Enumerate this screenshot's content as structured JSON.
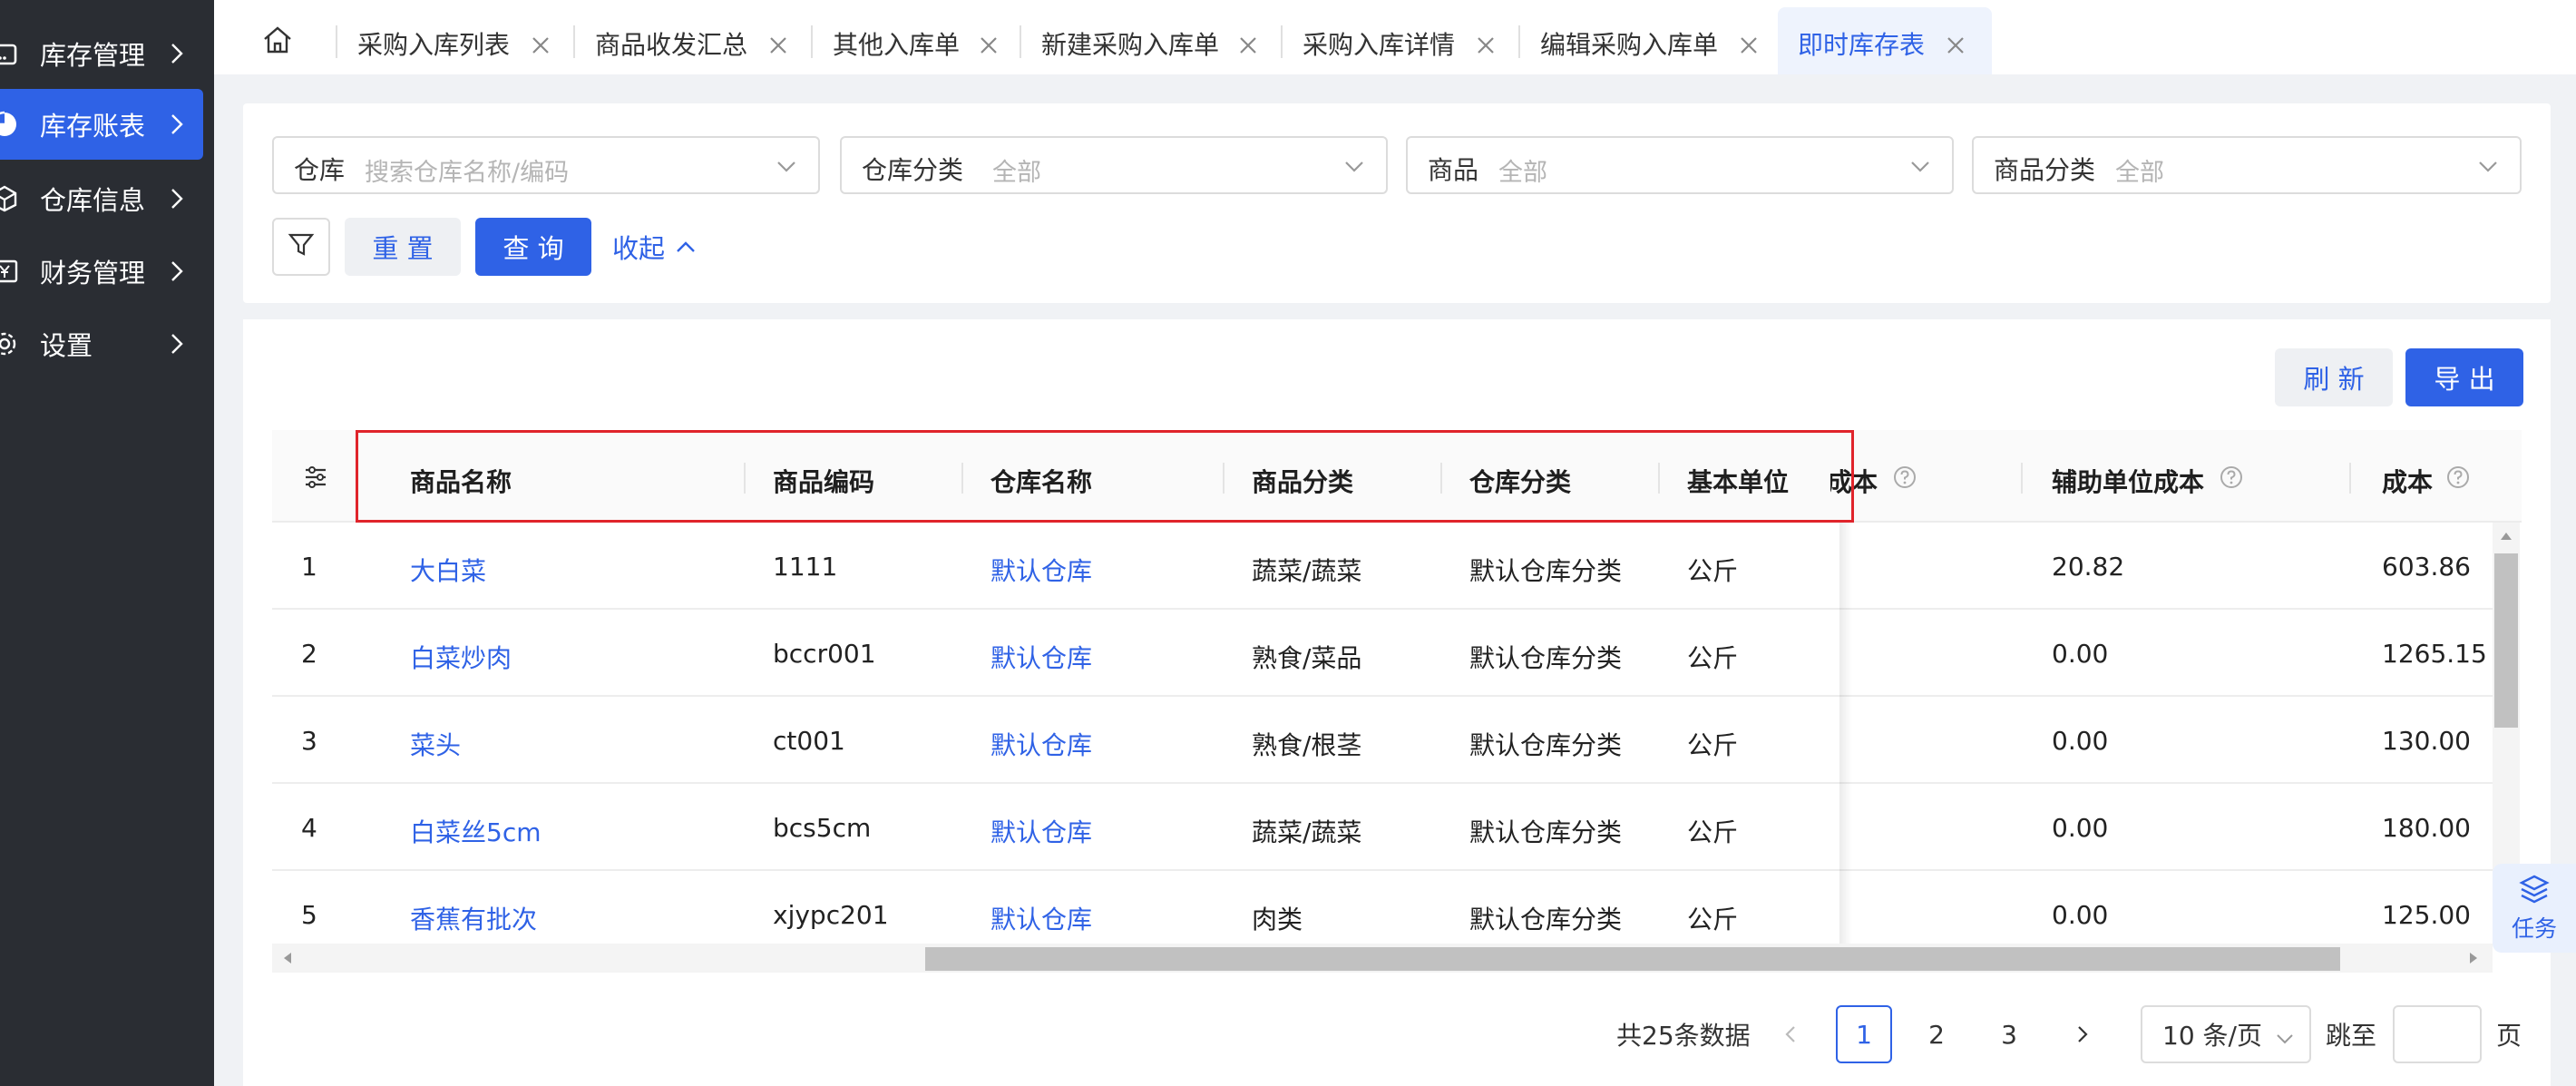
{
  "sidebar": {
    "items": [
      {
        "label": "库存管理",
        "icon": "warehouse-icon",
        "active": false
      },
      {
        "label": "库存账表",
        "icon": "pie-chart-icon",
        "active": true
      },
      {
        "label": "仓库信息",
        "icon": "cube-icon",
        "active": false
      },
      {
        "label": "财务管理",
        "icon": "yuan-register-icon",
        "active": false
      },
      {
        "label": "设置",
        "icon": "gear-icon",
        "active": false
      }
    ]
  },
  "tabs": {
    "home_icon": "home-icon",
    "items": [
      {
        "label": "采购入库列表",
        "active": false
      },
      {
        "label": "商品收发汇总",
        "active": false
      },
      {
        "label": "其他入库单",
        "active": false
      },
      {
        "label": "新建采购入库单",
        "active": false
      },
      {
        "label": "采购入库详情",
        "active": false
      },
      {
        "label": "编辑采购入库单",
        "active": false
      },
      {
        "label": "即时库存表",
        "active": true
      }
    ]
  },
  "filters": {
    "warehouse": {
      "label": "仓库",
      "placeholder": "搜索仓库名称/编码"
    },
    "warehouse_category": {
      "label": "仓库分类",
      "value": "全部"
    },
    "product": {
      "label": "商品",
      "value": "全部"
    },
    "product_category": {
      "label": "商品分类",
      "value": "全部"
    },
    "reset_label": "重 置",
    "query_label": "查 询",
    "collapse_label": "收起"
  },
  "toolbar": {
    "refresh_label": "刷 新",
    "export_label": "导 出"
  },
  "table": {
    "headers": {
      "name": "商品名称",
      "code": "商品编码",
      "warehouse": "仓库名称",
      "category": "商品分类",
      "warehouse_category": "仓库分类",
      "unit": "基本单位",
      "unit_cost_partial": "成本",
      "aux_unit_cost": "辅助单位成本",
      "cost": "成本"
    },
    "rows": [
      {
        "index": "1",
        "name": "大白菜",
        "code": "1111",
        "warehouse": "默认仓库",
        "category": "蔬菜/蔬菜",
        "warehouse_category": "默认仓库分类",
        "unit": "公斤",
        "aux_unit_cost": "20.82",
        "cost": "603.86"
      },
      {
        "index": "2",
        "name": "白菜炒肉",
        "code": "bccr001",
        "warehouse": "默认仓库",
        "category": "熟食/菜品",
        "warehouse_category": "默认仓库分类",
        "unit": "公斤",
        "aux_unit_cost": "0.00",
        "cost": "1265.15"
      },
      {
        "index": "3",
        "name": "菜头",
        "code": "ct001",
        "warehouse": "默认仓库",
        "category": "熟食/根茎",
        "warehouse_category": "默认仓库分类",
        "unit": "公斤",
        "aux_unit_cost": "0.00",
        "cost": "130.00"
      },
      {
        "index": "4",
        "name": "白菜丝5cm",
        "code": "bcs5cm",
        "warehouse": "默认仓库",
        "category": "蔬菜/蔬菜",
        "warehouse_category": "默认仓库分类",
        "unit": "公斤",
        "aux_unit_cost": "0.00",
        "cost": "180.00"
      },
      {
        "index": "5",
        "name": "香蕉有批次",
        "code": "xjypc201",
        "warehouse": "默认仓库",
        "category": "肉类",
        "warehouse_category": "默认仓库分类",
        "unit": "公斤",
        "aux_unit_cost": "0.00",
        "cost": "125.00"
      }
    ]
  },
  "pagination": {
    "total_text": "共25条数据",
    "pages": [
      "1",
      "2",
      "3"
    ],
    "current_page": "1",
    "page_size": "10 条/页",
    "jump_label": "跳至",
    "page_suffix": "页"
  },
  "float_task": {
    "label": "任务",
    "icon": "layers-icon"
  },
  "colors": {
    "sidebar_bg": "#2a2d33",
    "accent": "#2f62e6",
    "highlight_box": "#e0242b"
  }
}
